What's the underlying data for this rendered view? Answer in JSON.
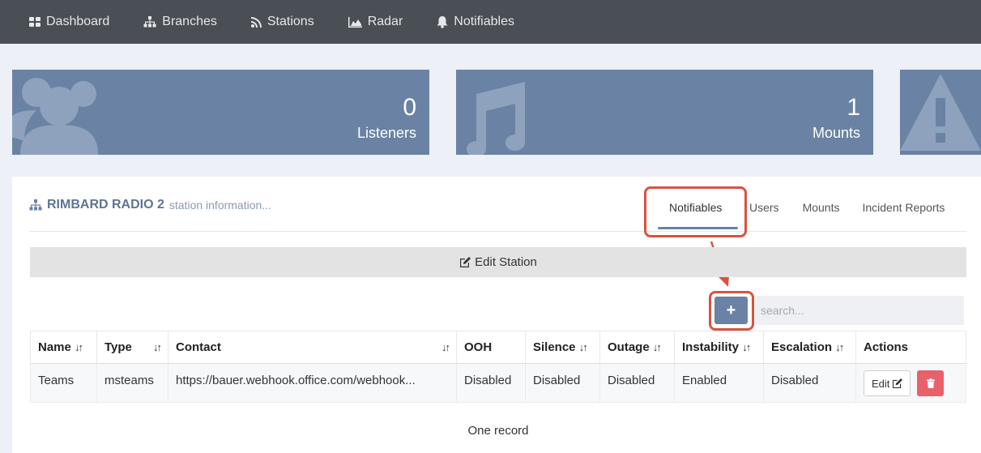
{
  "nav": {
    "dashboard": "Dashboard",
    "branches": "Branches",
    "stations": "Stations",
    "radar": "Radar",
    "notifiables": "Notifiables"
  },
  "cards": {
    "listeners": {
      "value": "0",
      "label": "Listeners"
    },
    "mounts": {
      "value": "1",
      "label": "Mounts"
    }
  },
  "station": {
    "name": "RIMBARD RADIO 2",
    "subtitle": "station information..."
  },
  "tabs": {
    "notifiables": "Notifiables",
    "users": "Users",
    "mounts": "Mounts",
    "incident_reports": "Incident Reports"
  },
  "edit_station_label": "Edit Station",
  "add_button_label": "+",
  "search_placeholder": "search...",
  "table": {
    "headers": {
      "name": "Name",
      "type": "Type",
      "contact": "Contact",
      "ooh": "OOH",
      "silence": "Silence",
      "outage": "Outage",
      "instability": "Instability",
      "escalation": "Escalation",
      "actions": "Actions"
    },
    "rows": [
      {
        "name": "Teams",
        "type": "msteams",
        "contact": "https://bauer.webhook.office.com/webhook...",
        "ooh": "Disabled",
        "silence": "Disabled",
        "outage": "Disabled",
        "instability": "Enabled",
        "escalation": "Disabled",
        "edit_label": "Edit"
      }
    ]
  },
  "record_count": "One record",
  "colors": {
    "nav_bg": "#4a4e55",
    "accent": "#6a82a3",
    "highlight": "#d9533f",
    "delete": "#e8616a"
  }
}
